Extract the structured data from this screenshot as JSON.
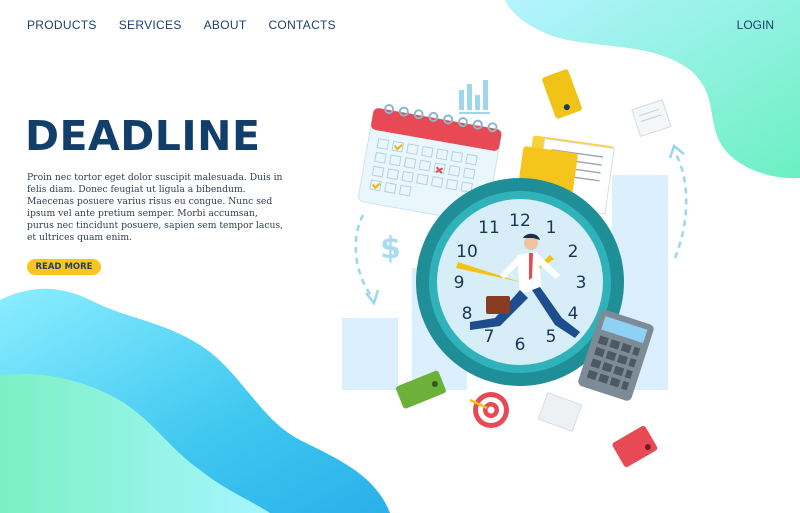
{
  "nav": {
    "items": [
      {
        "label": "PRODUCTS"
      },
      {
        "label": "SERVICES"
      },
      {
        "label": "ABOUT"
      },
      {
        "label": "CONTACTS"
      }
    ],
    "login_label": "LOGIN"
  },
  "hero": {
    "title": "DEADLINE",
    "body": "Proin nec tortor eget dolor suscipit malesuada. Duis in felis diam. Donec feugiat ut ligula a bibendum. Maecenas posuere varius risus eu congue. Nunc sed ipsum vel ante pretium semper. Morbi accumsan, purus nec tincidunt posuere, sapien sem tempor lacus, et ultrices quam enim.",
    "button_label": "READ MORE"
  },
  "illustration": {
    "clock_numbers": [
      "12",
      "1",
      "2",
      "3",
      "4",
      "5",
      "6",
      "7",
      "8",
      "9",
      "10",
      "11"
    ],
    "dollar_sign": "$"
  },
  "colors": {
    "nav_text": "#1d3f6e",
    "title": "#123f6a",
    "button": "#f9c71c",
    "mint": "#6cf0c2",
    "cyan": "#3fd0f0",
    "clock_ring": "#1f8e97",
    "calendar_red": "#e84a55",
    "folder_yellow": "#f7d23d"
  },
  "icons": [
    "bar-chart-icon",
    "calendar-icon",
    "folder-icon",
    "clock-icon",
    "dollar-icon",
    "calculator-icon",
    "target-icon",
    "wallet-icon",
    "paper-icon"
  ]
}
